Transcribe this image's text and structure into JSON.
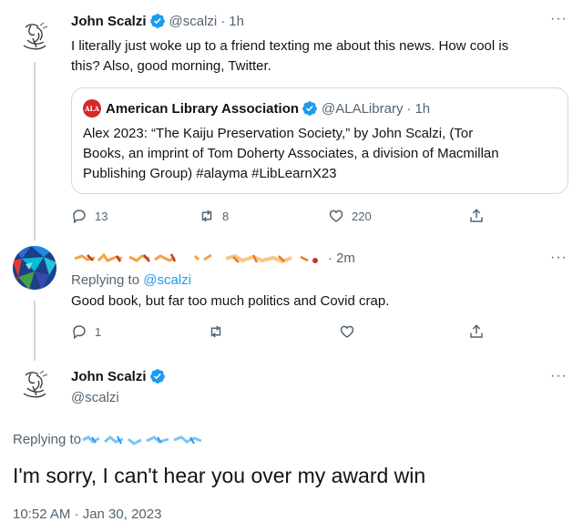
{
  "tweet1": {
    "name": "John Scalzi",
    "handle": "@scalzi",
    "time": "1h",
    "more": "···",
    "text_line1": "I literally just woke up to a friend texting me about this news. How cool is",
    "text_line2": "this? Also, good morning, Twitter.",
    "quote": {
      "avatar_text": "ALA",
      "name": "American Library Association",
      "handle": "@ALALibrary",
      "time": "1h",
      "line1": "Alex 2023: “The Kaiju Preservation Society,” by John Scalzi, (Tor",
      "line2": "Books, an imprint of Tom Doherty Associates, a division of Macmillan",
      "line3": "Publishing Group) #alayma #LibLearnX23"
    },
    "replies": "13",
    "retweets": "8",
    "likes": "220"
  },
  "tweet2": {
    "time": "2m",
    "more": "···",
    "replying_prefix": "Replying to ",
    "replying_handle": "@scalzi",
    "text": "Good book, but far too much politics and Covid crap.",
    "replies": "1"
  },
  "main_tweet": {
    "name": "John Scalzi",
    "handle": "@scalzi",
    "more": "···",
    "replying_prefix": "Replying to",
    "text": "I'm sorry, I can't hear you over my award win",
    "timestamp": "10:52 AM · Jan 30, 2023"
  },
  "colors": {
    "accent": "#1d9bf0",
    "secondary_text": "#536471",
    "border": "#cfd9de",
    "ala_red": "#d62828"
  },
  "icons": [
    "verified-badge-icon",
    "reply-icon",
    "retweet-icon",
    "like-icon",
    "share-icon",
    "more-icon"
  ]
}
